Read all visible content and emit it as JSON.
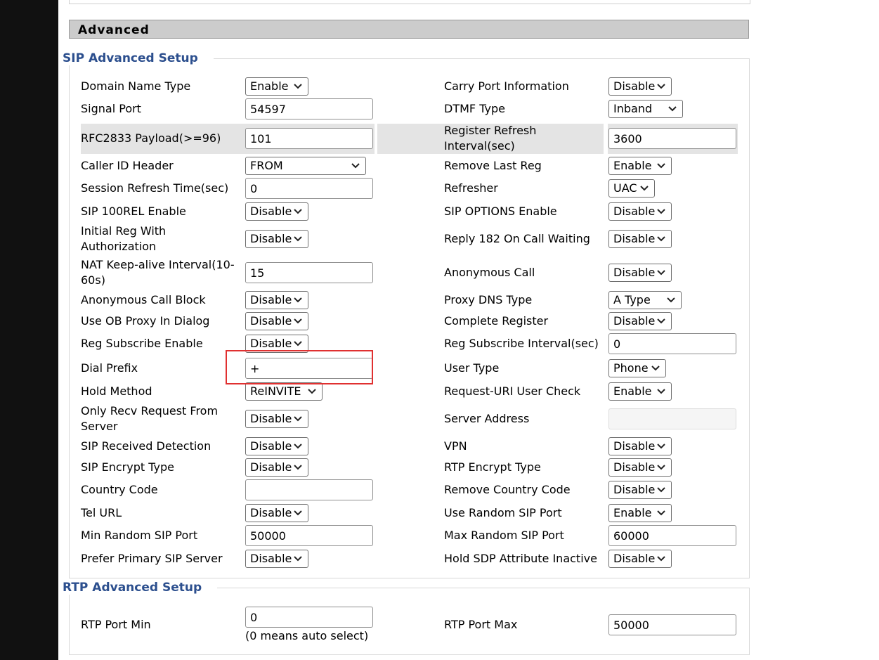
{
  "section_title": "Advanced",
  "sip_group": {
    "legend": "SIP Advanced Setup"
  },
  "rtp_group": {
    "legend": "RTP Advanced Setup"
  },
  "sip_fields": [
    {
      "id": "domain-name-type",
      "label": "Domain Name Type",
      "type": "select",
      "value": "Enable",
      "col": 0,
      "row": 0
    },
    {
      "id": "carry-port-information",
      "label": "Carry Port Information",
      "type": "select",
      "value": "Disable",
      "col": 1,
      "row": 0
    },
    {
      "id": "signal-port",
      "label": "Signal Port",
      "type": "text",
      "value": "54597",
      "col": 0,
      "row": 1
    },
    {
      "id": "dtmf-type",
      "label": "DTMF Type",
      "type": "select",
      "value": "Inband",
      "col": 1,
      "row": 1
    },
    {
      "id": "rfc2833-payload",
      "label": "RFC2833 Payload(>=96)",
      "type": "text",
      "value": "101",
      "col": 0,
      "row": 2
    },
    {
      "id": "register-refresh-interval",
      "label": "Register Refresh Interval(sec)",
      "type": "text",
      "value": "3600",
      "col": 1,
      "row": 2
    },
    {
      "id": "caller-id-header",
      "label": "Caller ID Header",
      "type": "select",
      "value": "FROM",
      "col": 0,
      "row": 3
    },
    {
      "id": "remove-last-reg",
      "label": "Remove Last Reg",
      "type": "select",
      "value": "Enable",
      "col": 1,
      "row": 3
    },
    {
      "id": "session-refresh-time",
      "label": "Session Refresh Time(sec)",
      "type": "text",
      "value": "0",
      "col": 0,
      "row": 4
    },
    {
      "id": "refresher",
      "label": "Refresher",
      "type": "select",
      "value": "UAC",
      "col": 1,
      "row": 4
    },
    {
      "id": "sip-100rel-enable",
      "label": "SIP 100REL Enable",
      "type": "select",
      "value": "Disable",
      "col": 0,
      "row": 5
    },
    {
      "id": "sip-options-enable",
      "label": "SIP OPTIONS Enable",
      "type": "select",
      "value": "Disable",
      "col": 1,
      "row": 5
    },
    {
      "id": "initial-reg-with-authorization",
      "label": "Initial Reg With Authorization",
      "type": "select",
      "value": "Disable",
      "col": 0,
      "row": 6
    },
    {
      "id": "reply-182-on-call-waiting",
      "label": "Reply 182 On Call Waiting",
      "type": "select",
      "value": "Disable",
      "col": 1,
      "row": 6
    },
    {
      "id": "nat-keep-alive-interval",
      "label": "NAT Keep-alive Interval(10-60s)",
      "type": "text",
      "value": "15",
      "col": 0,
      "row": 7
    },
    {
      "id": "anonymous-call",
      "label": "Anonymous Call",
      "type": "select",
      "value": "Disable",
      "col": 1,
      "row": 7
    },
    {
      "id": "anonymous-call-block",
      "label": "Anonymous Call Block",
      "type": "select",
      "value": "Disable",
      "col": 0,
      "row": 8
    },
    {
      "id": "proxy-dns-type",
      "label": "Proxy DNS Type",
      "type": "select",
      "value": "A Type",
      "col": 1,
      "row": 8
    },
    {
      "id": "use-ob-proxy-in-dialog",
      "label": "Use OB Proxy In Dialog",
      "type": "select",
      "value": "Disable",
      "col": 0,
      "row": 9
    },
    {
      "id": "complete-register",
      "label": "Complete Register",
      "type": "select",
      "value": "Disable",
      "col": 1,
      "row": 9
    },
    {
      "id": "reg-subscribe-enable",
      "label": "Reg Subscribe Enable",
      "type": "select",
      "value": "Disable",
      "col": 0,
      "row": 10
    },
    {
      "id": "reg-subscribe-interval",
      "label": "Reg Subscribe Interval(sec)",
      "type": "text",
      "value": "0",
      "col": 1,
      "row": 10
    },
    {
      "id": "dial-prefix",
      "label": "Dial Prefix",
      "type": "text",
      "value": "+",
      "col": 0,
      "row": 11
    },
    {
      "id": "user-type",
      "label": "User Type",
      "type": "select",
      "value": "Phone",
      "col": 1,
      "row": 11
    },
    {
      "id": "hold-method",
      "label": "Hold Method",
      "type": "select",
      "value": "ReINVITE",
      "col": 0,
      "row": 12
    },
    {
      "id": "request-uri-user-check",
      "label": "Request-URI User Check",
      "type": "select",
      "value": "Enable",
      "col": 1,
      "row": 12
    },
    {
      "id": "only-recv-request-from-server",
      "label": "Only Recv Request From Server",
      "type": "select",
      "value": "Disable",
      "col": 0,
      "row": 13
    },
    {
      "id": "server-address",
      "label": "Server Address",
      "type": "text",
      "value": "",
      "disabled": true,
      "col": 1,
      "row": 13
    },
    {
      "id": "sip-received-detection",
      "label": "SIP Received Detection",
      "type": "select",
      "value": "Disable",
      "col": 0,
      "row": 14
    },
    {
      "id": "vpn",
      "label": "VPN",
      "type": "select",
      "value": "Disable",
      "col": 1,
      "row": 14
    },
    {
      "id": "sip-encrypt-type",
      "label": "SIP Encrypt Type",
      "type": "select",
      "value": "Disable",
      "col": 0,
      "row": 15
    },
    {
      "id": "rtp-encrypt-type",
      "label": "RTP Encrypt Type",
      "type": "select",
      "value": "Disable",
      "col": 1,
      "row": 15
    },
    {
      "id": "country-code",
      "label": "Country Code",
      "type": "text",
      "value": "",
      "col": 0,
      "row": 16
    },
    {
      "id": "remove-country-code",
      "label": "Remove Country Code",
      "type": "select",
      "value": "Disable",
      "col": 1,
      "row": 16
    },
    {
      "id": "tel-url",
      "label": "Tel URL",
      "type": "select",
      "value": "Disable",
      "col": 0,
      "row": 17
    },
    {
      "id": "use-random-sip-port",
      "label": "Use Random SIP Port",
      "type": "select",
      "value": "Enable",
      "col": 1,
      "row": 17
    },
    {
      "id": "min-random-sip-port",
      "label": "Min Random SIP Port",
      "type": "text",
      "value": "50000",
      "col": 0,
      "row": 18
    },
    {
      "id": "max-random-sip-port",
      "label": "Max Random SIP Port",
      "type": "text",
      "value": "60000",
      "col": 1,
      "row": 18
    },
    {
      "id": "prefer-primary-sip-server",
      "label": "Prefer Primary SIP Server",
      "type": "select",
      "value": "Disable",
      "col": 0,
      "row": 19
    },
    {
      "id": "hold-sdp-attribute-inactive",
      "label": "Hold SDP Attribute Inactive",
      "type": "select",
      "value": "Disable",
      "col": 1,
      "row": 19
    }
  ],
  "rtp_fields": [
    {
      "id": "rtp-port-min",
      "label": "RTP Port Min",
      "type": "text",
      "value": "0",
      "note": "(0 means auto select)",
      "col": 0
    },
    {
      "id": "rtp-port-max",
      "label": "RTP Port Max",
      "type": "text",
      "value": "50000",
      "col": 1
    }
  ],
  "icons": {
    "dropdown": "chevron-down-icon"
  },
  "colors": {
    "legend": "#2c4f8e",
    "header_bg": "#cccccc",
    "highlight": "#e03030",
    "left_bar": "#111111"
  }
}
